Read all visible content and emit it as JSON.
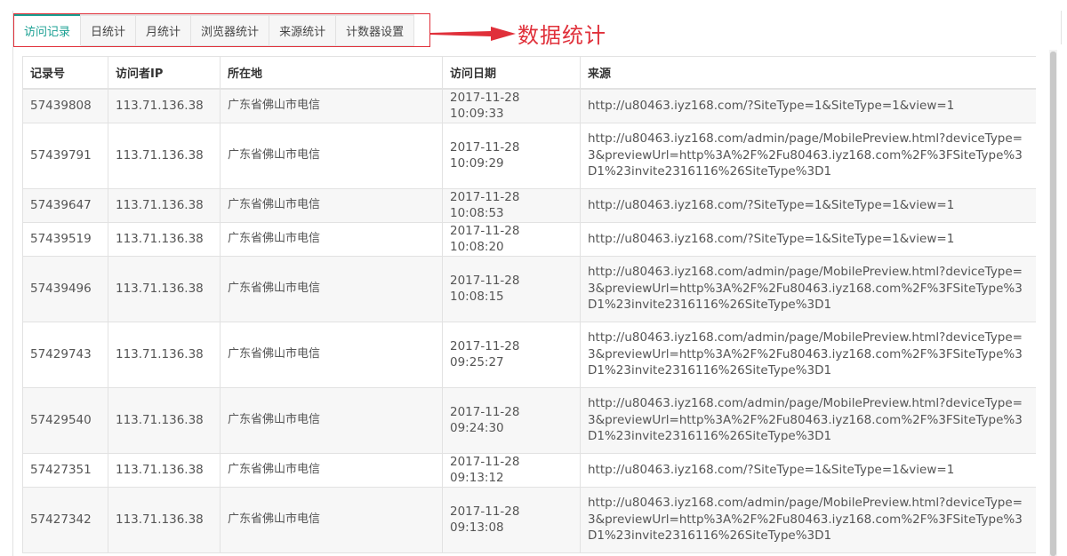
{
  "tabs": [
    "访问记录",
    "日统计",
    "月统计",
    "浏览器统计",
    "来源统计",
    "计数器设置"
  ],
  "annotation": {
    "text": "数据统计",
    "color": "#e0303a"
  },
  "accent_color": "#1aa093",
  "table": {
    "headers": [
      "记录号",
      "访问者IP",
      "所在地",
      "访问日期",
      "来源"
    ],
    "rows": [
      {
        "id": "57439808",
        "ip": "113.71.136.38",
        "location": "广东省佛山市电信",
        "date": "2017-11-28 10:09:33",
        "source": "http://u80463.iyz168.com/?SiteType=1&SiteType=1&view=1"
      },
      {
        "id": "57439791",
        "ip": "113.71.136.38",
        "location": "广东省佛山市电信",
        "date": "2017-11-28 10:09:29",
        "source": "http://u80463.iyz168.com/admin/page/MobilePreview.html?deviceType=3&previewUrl=http%3A%2F%2Fu80463.iyz168.com%2F%3FSiteType%3D1%23invite2316116%26SiteType%3D1"
      },
      {
        "id": "57439647",
        "ip": "113.71.136.38",
        "location": "广东省佛山市电信",
        "date": "2017-11-28 10:08:53",
        "source": "http://u80463.iyz168.com/?SiteType=1&SiteType=1&view=1"
      },
      {
        "id": "57439519",
        "ip": "113.71.136.38",
        "location": "广东省佛山市电信",
        "date": "2017-11-28 10:08:20",
        "source": "http://u80463.iyz168.com/?SiteType=1&SiteType=1&view=1"
      },
      {
        "id": "57439496",
        "ip": "113.71.136.38",
        "location": "广东省佛山市电信",
        "date": "2017-11-28 10:08:15",
        "source": "http://u80463.iyz168.com/admin/page/MobilePreview.html?deviceType=3&previewUrl=http%3A%2F%2Fu80463.iyz168.com%2F%3FSiteType%3D1%23invite2316116%26SiteType%3D1"
      },
      {
        "id": "57429743",
        "ip": "113.71.136.38",
        "location": "广东省佛山市电信",
        "date": "2017-11-28 09:25:27",
        "source": "http://u80463.iyz168.com/admin/page/MobilePreview.html?deviceType=3&previewUrl=http%3A%2F%2Fu80463.iyz168.com%2F%3FSiteType%3D1%23invite2316116%26SiteType%3D1"
      },
      {
        "id": "57429540",
        "ip": "113.71.136.38",
        "location": "广东省佛山市电信",
        "date": "2017-11-28 09:24:30",
        "source": "http://u80463.iyz168.com/admin/page/MobilePreview.html?deviceType=3&previewUrl=http%3A%2F%2Fu80463.iyz168.com%2F%3FSiteType%3D1%23invite2316116%26SiteType%3D1"
      },
      {
        "id": "57427351",
        "ip": "113.71.136.38",
        "location": "广东省佛山市电信",
        "date": "2017-11-28 09:13:12",
        "source": "http://u80463.iyz168.com/?SiteType=1&SiteType=1&view=1"
      },
      {
        "id": "57427342",
        "ip": "113.71.136.38",
        "location": "广东省佛山市电信",
        "date": "2017-11-28 09:13:08",
        "source": "http://u80463.iyz168.com/admin/page/MobilePreview.html?deviceType=3&previewUrl=http%3A%2F%2Fu80463.iyz168.com%2F%3FSiteType%3D1%23invite2316116%26SiteType%3D1"
      }
    ]
  }
}
